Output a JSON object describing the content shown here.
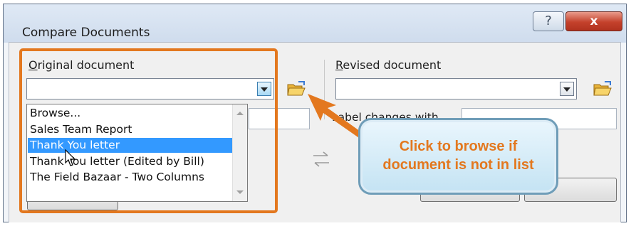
{
  "window": {
    "title": "Compare Documents",
    "help_label": "?",
    "close_label": "x"
  },
  "original": {
    "label_prefix": "O",
    "label_rest": "riginal document",
    "value": "",
    "dropdown_items": [
      {
        "label": "Browse...",
        "selected": false
      },
      {
        "label": "Sales Team Report",
        "selected": false
      },
      {
        "label": "Thank You letter",
        "selected": true
      },
      {
        "label": "Thank You letter (Edited by Bill)",
        "selected": false
      },
      {
        "label": "The Field Bazaar - Two Columns",
        "selected": false
      }
    ]
  },
  "revised": {
    "label_prefix": "R",
    "label_rest": "evised document",
    "value": "",
    "label_changes_text": "Label changes with"
  },
  "callout": {
    "line1": "Click to browse if",
    "line2": "document is not in list"
  },
  "colors": {
    "highlight": "#e3781f",
    "callout_text": "#e3781f",
    "selection": "#3399ff"
  },
  "icons": [
    "folder-open-icon",
    "swap-arrows-icon",
    "mouse-cursor-icon",
    "dropdown-arrow-icon"
  ]
}
